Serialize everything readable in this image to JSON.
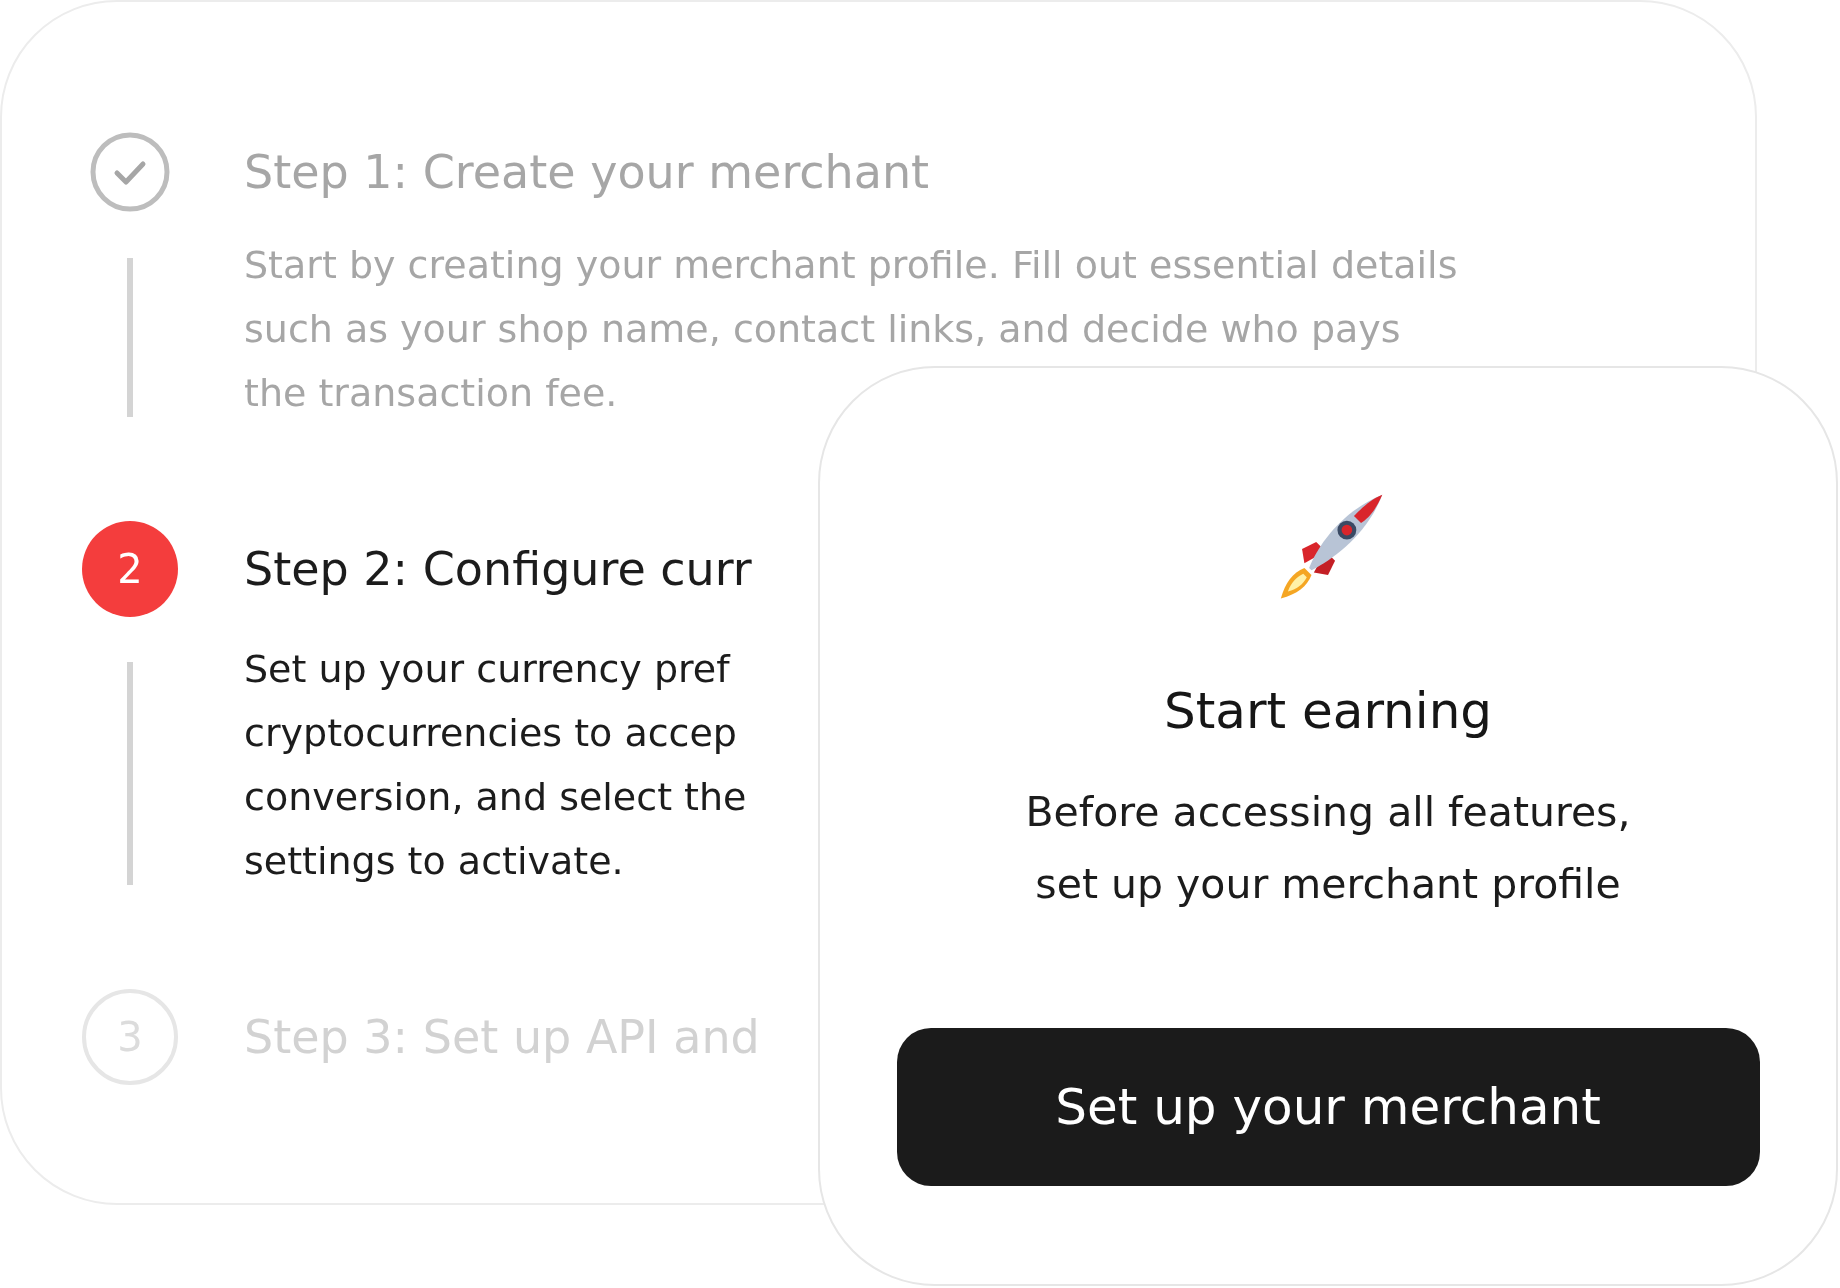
{
  "steps": [
    {
      "kind": "done",
      "title": "Step 1: Create your merchant",
      "lines": [
        "Start by creating your merchant profile. Fill out essential details",
        "such as your shop name, contact links, and decide who pays",
        "the transaction fee."
      ]
    },
    {
      "kind": "current",
      "number": "2",
      "title": "Step 2: Configure curr",
      "lines": [
        "Set up your currency pref",
        "cryptocurrencies to accep",
        "conversion, and select the",
        "settings to activate."
      ]
    },
    {
      "kind": "upcoming",
      "number": "3",
      "title": "Step 3: Set up API and"
    }
  ],
  "dialog": {
    "title": "Start earning",
    "message_lines": [
      "Before accessing all features,",
      "set up your merchant profile"
    ],
    "button": "Set up your merchant"
  }
}
